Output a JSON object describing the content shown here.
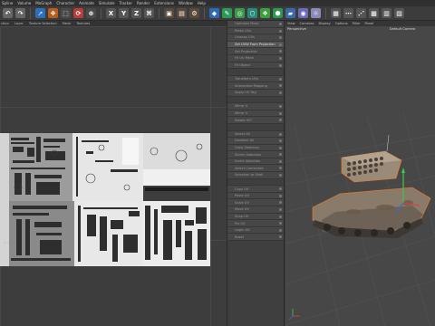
{
  "menubar": [
    "Spline",
    "Volume",
    "MoGraph",
    "Character",
    "Animate",
    "Simulate",
    "Tracker",
    "Render",
    "Extensions",
    "Window",
    "Help"
  ],
  "uv_toolbar": [
    "View",
    "Cameras",
    "Display",
    "Options",
    "Filter",
    "Panel"
  ],
  "uv_menu": [
    "ction",
    "Layer",
    "Texture Selection",
    "Mesh",
    "Textures"
  ],
  "uv_coord_label": "0,0",
  "panel_items": [
    {
      "label": "Optimize Mesh",
      "active": false
    },
    {
      "label": "Relax UVs",
      "active": false
    },
    {
      "label": "Unwrap UVs",
      "active": false
    },
    {
      "label": "Set UVW From Projection",
      "active": true
    },
    {
      "label": "Set Projection",
      "active": false
    },
    {
      "label": "Fit UV Mesh",
      "active": false
    },
    {
      "label": "Fit Object",
      "active": false
    },
    {
      "label": "",
      "active": false
    },
    {
      "label": "Transform UVs",
      "active": false
    },
    {
      "label": "Interactive Mapping",
      "active": false
    },
    {
      "label": "Apply UV Tag",
      "active": false
    },
    {
      "label": "",
      "active": false
    },
    {
      "label": "Mirror U",
      "active": false
    },
    {
      "label": "Mirror V",
      "active": false
    },
    {
      "label": "Rotate 90°",
      "active": false
    },
    {
      "label": "",
      "active": false
    },
    {
      "label": "Select All",
      "active": false
    },
    {
      "label": "Deselect All",
      "active": false
    },
    {
      "label": "Grow Selection",
      "active": false
    },
    {
      "label": "Shrink Selection",
      "active": false
    },
    {
      "label": "Invert Selection",
      "active": false
    },
    {
      "label": "Select Connected",
      "active": false
    },
    {
      "label": "Selection to Shell",
      "active": false
    },
    {
      "label": "",
      "active": false
    },
    {
      "label": "Copy UV",
      "active": false
    },
    {
      "label": "Paste UV",
      "active": false
    },
    {
      "label": "Scale UV",
      "active": false
    },
    {
      "label": "Move UV",
      "active": false
    },
    {
      "label": "Snap UV",
      "active": false
    },
    {
      "label": "Pin UV",
      "active": false
    },
    {
      "label": "Unpin UV",
      "active": false
    },
    {
      "label": "Reset",
      "active": false
    }
  ],
  "viewport": {
    "mode": "Perspective",
    "camera": "Default Camera",
    "menu": [
      "View",
      "Cameras",
      "Display",
      "Options",
      "Filter",
      "Panel"
    ]
  },
  "colors": {
    "accent": "#f0a030",
    "selection": "#ff7a1a",
    "axis_y": "#3ec64a",
    "axis_x": "#d84040",
    "axis_z": "#3a6ad8"
  }
}
